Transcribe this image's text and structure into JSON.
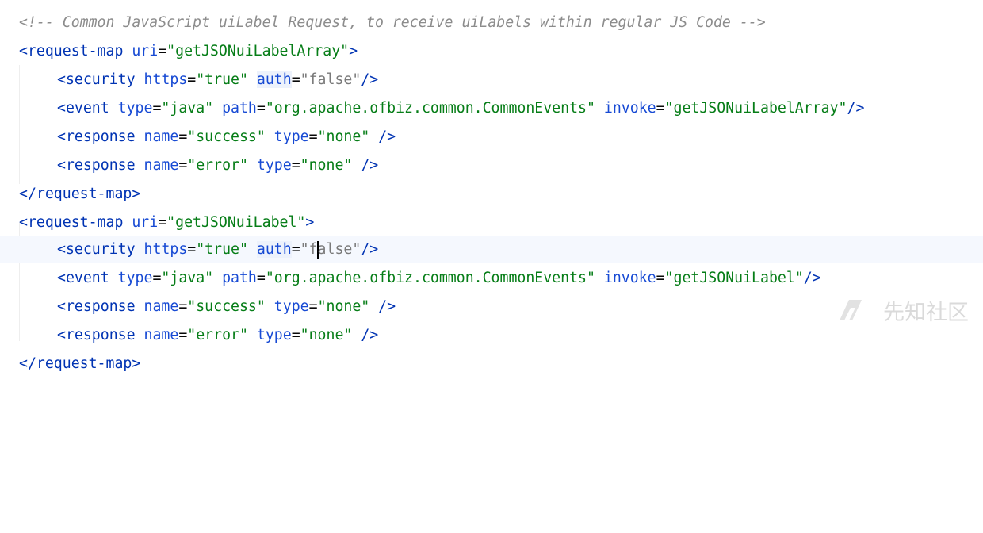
{
  "editor": {
    "lines": [
      {
        "comment": "<!-- Common JavaScript uiLabel Request, to receive uiLabels within regular JS Code -->"
      },
      {
        "open": "<request-map",
        "a1": "uri",
        "v1": "\"getJSONuiLabelArray\"",
        "close": ">"
      },
      {
        "open": "<security",
        "a1": "https",
        "v1": "\"true\"",
        "a2": "auth",
        "v2": "\"false\"",
        "close": "/>"
      },
      {
        "open": "<event",
        "a1": "type",
        "v1": "\"java\"",
        "a2": "path",
        "v2": "\"org.apache.ofbiz.common.CommonEvents\"",
        "a3": "invoke",
        "v3": "\"getJSONuiLabelArray\"",
        "close": "/>"
      },
      {
        "open": "<response",
        "a1": "name",
        "v1": "\"success\"",
        "a2": "type",
        "v2": "\"none\"",
        "close": "/>"
      },
      {
        "open": "<response",
        "a1": "name",
        "v1": "\"error\"",
        "a2": "type",
        "v2": "\"none\"",
        "close": "/>"
      },
      {
        "tag": "</request-map>"
      },
      {
        "open": "<request-map",
        "a1": "uri",
        "v1": "\"getJSONuiLabel\"",
        "close": ">"
      },
      {
        "open": "<security",
        "a1": "https",
        "v1": "\"true\"",
        "a2": "auth",
        "v2a": "\"f",
        "v2b": "alse\"",
        "close": "/>"
      },
      {
        "open": "<event",
        "a1": "type",
        "v1": "\"java\"",
        "a2": "path",
        "v2": "\"org.apache.ofbiz.common.CommonEvents\"",
        "a3": "invoke",
        "v3": "\"getJSONuiLabel\"",
        "close": "/>"
      },
      {
        "open": "<response",
        "a1": "name",
        "v1": "\"success\"",
        "a2": "type",
        "v2": "\"none\"",
        "close": "/>"
      },
      {
        "open": "<response",
        "a1": "name",
        "v1": "\"error\"",
        "a2": "type",
        "v2": "\"none\"",
        "close": "/>"
      },
      {
        "tag": "</request-map>"
      }
    ]
  },
  "watermark": {
    "text": "先知社区",
    "logo_icon": "xianzhi-logo-icon"
  },
  "colors": {
    "tag": "#0033b3",
    "attribute": "#174ad4",
    "string": "#067d17",
    "comment": "#8c8c8c",
    "current_line": "#f5f8fe"
  }
}
